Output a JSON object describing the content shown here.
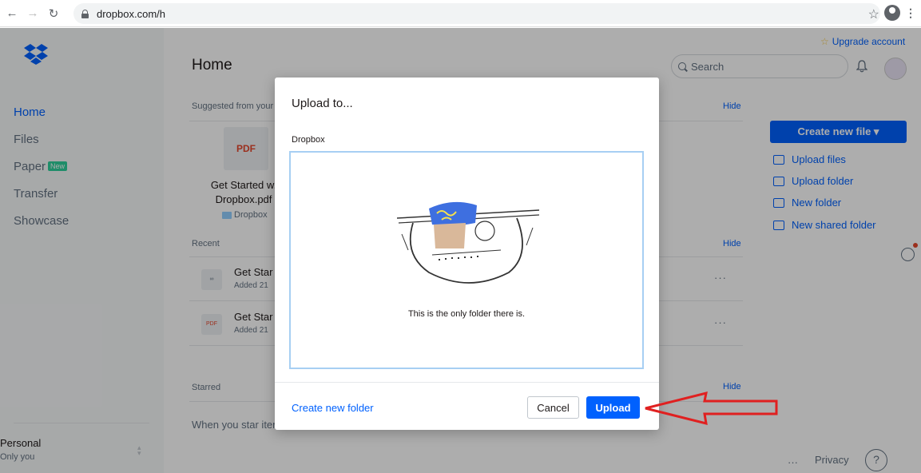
{
  "browser": {
    "url": "dropbox.com/h"
  },
  "sidebar": {
    "items": [
      {
        "label": "Home"
      },
      {
        "label": "Files"
      },
      {
        "label": "Paper",
        "badge": "New"
      },
      {
        "label": "Transfer"
      },
      {
        "label": "Showcase"
      }
    ],
    "account_name": "Personal",
    "account_sub": "Only you"
  },
  "header": {
    "title": "Home",
    "search_placeholder": "Search",
    "upgrade_label": "Upgrade account"
  },
  "suggested": {
    "label": "Suggested from your",
    "hide": "Hide",
    "card": {
      "thumb": "PDF",
      "name": "Get Started w. Dropbox.pdf",
      "folder": "Dropbox"
    }
  },
  "recent": {
    "label": "Recent",
    "hide": "Hide",
    "rows": [
      {
        "icon": "∞",
        "title": "Get Star",
        "sub": "Added 21",
        "more": "···"
      },
      {
        "icon": "PDF",
        "title": "Get Star",
        "sub": "Added 21",
        "more": "···"
      }
    ]
  },
  "starred": {
    "label": "Starred",
    "hide": "Hide",
    "message": "When you star iter"
  },
  "actions": {
    "create_label": "Create new file ▾",
    "items": [
      {
        "label": "Upload files"
      },
      {
        "label": "Upload folder"
      },
      {
        "label": "New folder"
      },
      {
        "label": "New shared folder"
      }
    ]
  },
  "footer": {
    "more": "···",
    "privacy": "Privacy",
    "help": "?"
  },
  "modal": {
    "title": "Upload to...",
    "path": "Dropbox",
    "empty_message": "This is the only folder there is.",
    "create_folder_link": "Create new folder",
    "cancel_label": "Cancel",
    "upload_label": "Upload"
  },
  "colors": {
    "accent": "#0061fe",
    "annotation_arrow": "#e02020"
  }
}
